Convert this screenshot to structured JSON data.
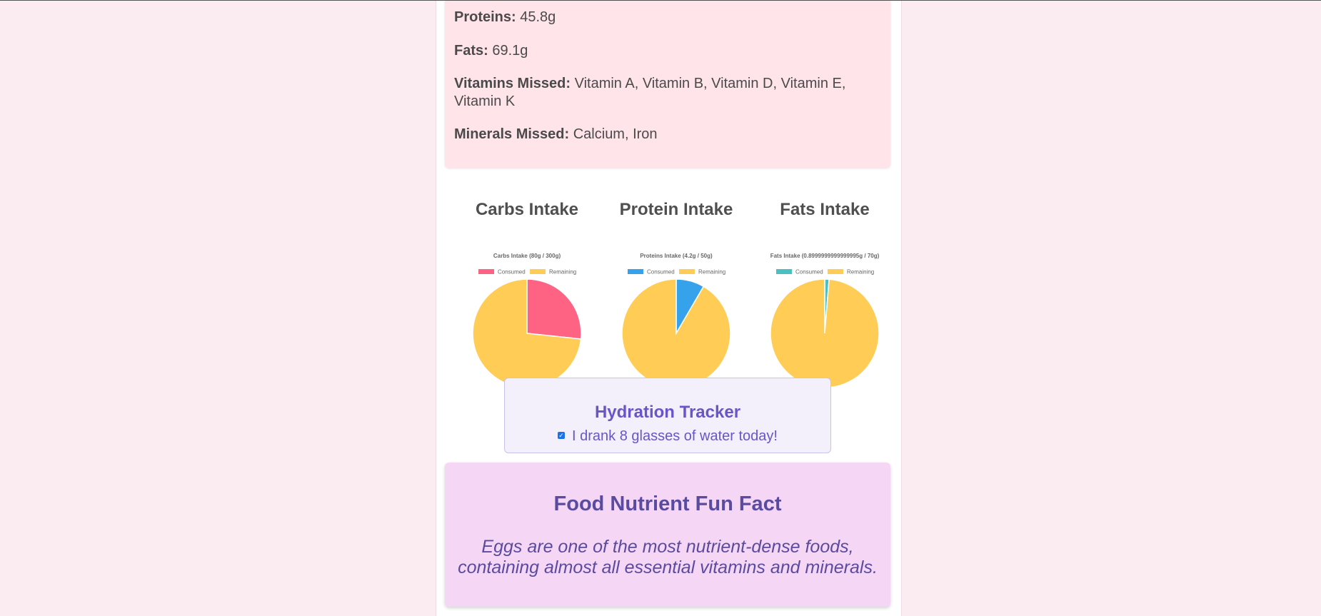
{
  "summary": {
    "proteins_label": "Proteins:",
    "proteins_value": "45.8g",
    "fats_label": "Fats:",
    "fats_value": "69.1g",
    "vitamins_label": "Vitamins Missed:",
    "vitamins_value": "Vitamin A, Vitamin B, Vitamin D, Vitamin E, Vitamin K",
    "minerals_label": "Minerals Missed:",
    "minerals_value": "Calcium, Iron"
  },
  "charts_section": {
    "carbs_heading": "Carbs Intake",
    "protein_heading": "Protein Intake",
    "fats_heading": "Fats Intake"
  },
  "chart_data": [
    {
      "type": "pie",
      "title": "Carbs Intake (80g / 300g)",
      "categories": [
        "Consumed",
        "Remaining"
      ],
      "values": [
        80,
        220
      ],
      "colors": [
        "#ff6384",
        "#ffcd56"
      ],
      "legend": "top"
    },
    {
      "type": "pie",
      "title": "Proteins Intake (4.2g / 50g)",
      "categories": [
        "Consumed",
        "Remaining"
      ],
      "values": [
        4.2,
        45.8
      ],
      "colors": [
        "#36a2eb",
        "#ffcd56"
      ],
      "legend": "top"
    },
    {
      "type": "pie",
      "title": "Fats Intake (0.8999999999999995g / 70g)",
      "categories": [
        "Consumed",
        "Remaining"
      ],
      "values": [
        0.9,
        69.1
      ],
      "colors": [
        "#4bc0c0",
        "#ffcd56"
      ],
      "legend": "top"
    }
  ],
  "hydration": {
    "title": "Hydration Tracker",
    "checkbox_label": "I drank 8 glasses of water today!",
    "checked": true
  },
  "funfact": {
    "title": "Food Nutrient Fun Fact",
    "text": "Eggs are one of the most nutrient-dense foods, containing almost all essential vitamins and minerals."
  },
  "colors": {
    "background": "#fbecf2",
    "summary_bg": "#ffe4ea",
    "hydration_bg": "#f3f0fb",
    "hydration_text": "#6a55c8",
    "funfact_bg": "#f5d6f4",
    "funfact_text": "#5a4ba0"
  }
}
